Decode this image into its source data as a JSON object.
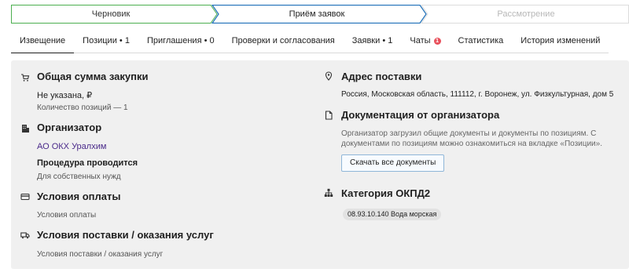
{
  "stepper": {
    "steps": [
      {
        "label": "Черновик",
        "state": "done"
      },
      {
        "label": "Приём заявок",
        "state": "current"
      },
      {
        "label": "Рассмотрение",
        "state": "upcoming"
      }
    ],
    "done_color": "#4caf50",
    "current_color": "#1e6fb8"
  },
  "tabs": [
    {
      "label": "Извещение",
      "active": true
    },
    {
      "label": "Позиции • 1"
    },
    {
      "label": "Приглашения • 0"
    },
    {
      "label": "Проверки и согласования"
    },
    {
      "label": "Заявки • 1"
    },
    {
      "label": "Чаты",
      "badge": "1"
    },
    {
      "label": "Статистика"
    },
    {
      "label": "История изменений"
    }
  ],
  "left": {
    "total": {
      "icon": "cart-icon",
      "title": "Общая сумма закупки",
      "value": "Не указана, ₽",
      "note": "Количество позиций — 1"
    },
    "organizer": {
      "icon": "building-icon",
      "title": "Организатор",
      "name": "АО ОКХ Уралхим",
      "procedure_title": "Процедура проводится",
      "procedure_value": "Для собственных нужд"
    },
    "payment": {
      "icon": "card-icon",
      "title": "Условия оплаты",
      "value": "Условия оплаты"
    },
    "delivery": {
      "icon": "truck-icon",
      "title": "Условия поставки / оказания услуг",
      "value": "Условия поставки / оказания услуг"
    }
  },
  "right": {
    "address": {
      "icon": "map-pin-icon",
      "title": "Адрес поставки",
      "value": "Россия, Московская область, 111112, г. Воронеж, ул. Физкультурная, дом 5"
    },
    "docs": {
      "icon": "document-icon",
      "title": "Документация от организатора",
      "text": "Организатор загрузил общие документы и документы по позициям. С документами по позициям можно ознакомиться на вкладке «Позиции».",
      "button": "Скачать все документы"
    },
    "okpd": {
      "icon": "hierarchy-icon",
      "title": "Категория ОКПД2",
      "chip": "08.93.10.140 Вода морская"
    }
  }
}
